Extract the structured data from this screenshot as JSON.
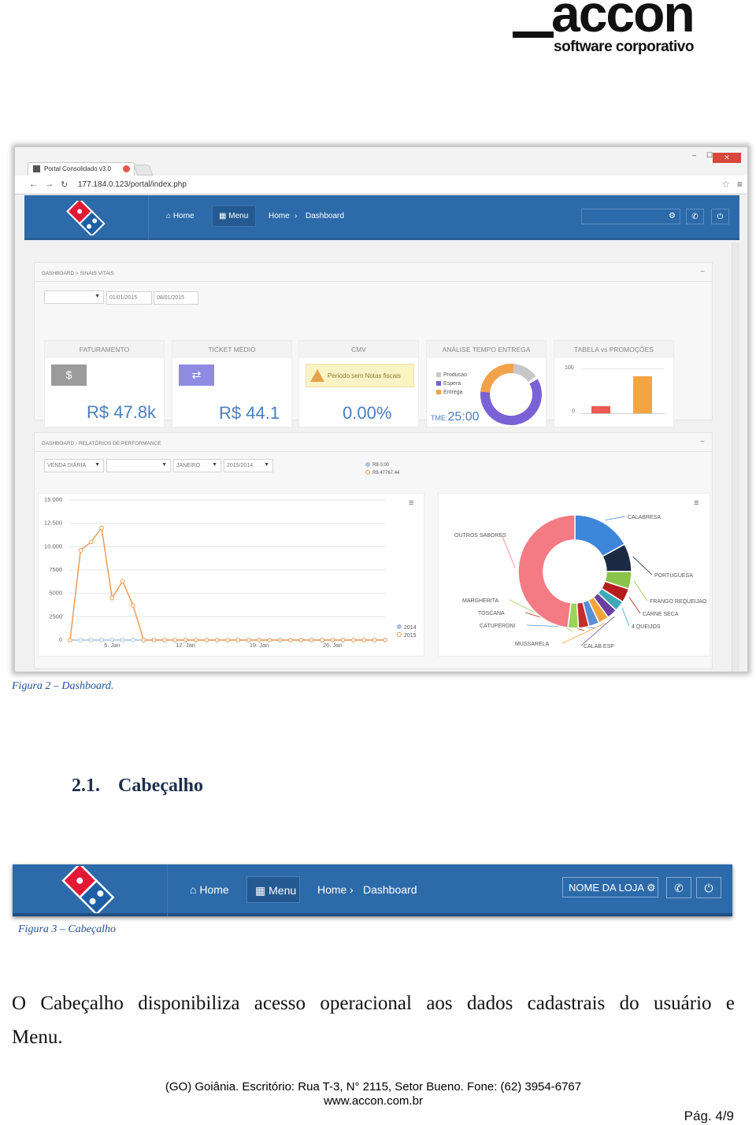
{
  "logo": {
    "word": "accon",
    "tagline": "software corporativo"
  },
  "browser": {
    "tab_title": "Portal Consolidado v3.0",
    "url": "177.184.0.123/portal/index.php",
    "close": "✕",
    "minimize": "–",
    "maximize": "☐"
  },
  "app_header": {
    "home": "Home",
    "menu": "Menu",
    "breadcrumb_home": "Home",
    "breadcrumb_dashboard": "Dashboard"
  },
  "vitals": {
    "title": "DASHBOARD > SINAIS VITAIS",
    "date_from": "01/01/2015",
    "date_to": "08/01/2015",
    "faturamento": {
      "title": "FATURAMENTO",
      "value": "R$ 47.8k"
    },
    "ticket": {
      "title": "TICKET MÉDIO",
      "value": "R$ 44.1"
    },
    "cmv": {
      "title": "CMV",
      "warning": "Período sem Notas fiscais",
      "value": "0.00%"
    },
    "tempo": {
      "title": "ANÁLISE TEMPO ENTREGA",
      "legend": [
        "Producao",
        "Espera",
        "Entrega"
      ],
      "tme_label": "TME:",
      "tme_value": "25:00"
    },
    "tabela": {
      "title": "TABELA vs PROMOÇÕES",
      "y_top": "100",
      "y_bottom": "0"
    }
  },
  "perf": {
    "title": "DASHBOARD › RELATÓRIOS DE PERFORMANCE",
    "filters": [
      "VENDA DIÁRIA",
      "",
      "JANEIRO",
      "2015/2014"
    ],
    "legend": [
      "R$ 0.00",
      "R$ 47767.44"
    ]
  },
  "chart_data": [
    {
      "type": "line",
      "title": "",
      "yticks": [
        "15.000",
        "12.500",
        "10.000",
        "7500",
        "5000",
        "2500",
        "0"
      ],
      "xticks": [
        "5. Jan",
        "12. Jan",
        "19. Jan",
        "26. Jan"
      ],
      "ylim": [
        0,
        15000
      ],
      "x": [
        1,
        2,
        3,
        4,
        5,
        6,
        7,
        8,
        9,
        10,
        11,
        12,
        13,
        14,
        15,
        16,
        17,
        18,
        19,
        20,
        21,
        22,
        23,
        24,
        25,
        26,
        27,
        28,
        29,
        30,
        31
      ],
      "series": [
        {
          "name": "2014",
          "color": "#a9c1e2",
          "values": [
            0,
            0,
            0,
            0,
            0,
            0,
            0,
            0,
            0,
            0,
            0,
            0,
            0,
            0,
            0,
            0,
            0,
            0,
            0,
            0,
            0,
            0,
            0,
            0,
            0,
            0,
            0,
            0,
            0,
            0,
            0
          ]
        },
        {
          "name": "2015",
          "color": "#ee9b55",
          "values": [
            0,
            9600,
            10500,
            12000,
            4500,
            6300,
            3700,
            0,
            0,
            0,
            0,
            0,
            0,
            0,
            0,
            0,
            0,
            0,
            0,
            0,
            0,
            0,
            0,
            0,
            0,
            0,
            0,
            0,
            0,
            0,
            0
          ]
        }
      ]
    },
    {
      "type": "pie",
      "title": "",
      "labels": [
        "CALABRESA",
        "PORTUGUESA",
        "FRANGO REQUEIJAO",
        "CARNE SECA",
        "4 QUEIJOS",
        "CALAB ESP",
        "MUSSARELA",
        "CATUPERONI",
        "TOSCANA",
        "MARGHERITA",
        "OUTROS SABORES"
      ],
      "values": [
        17,
        8,
        5,
        4,
        3,
        3,
        3,
        3,
        3,
        3,
        48
      ],
      "colors": [
        "#3d86d9",
        "#1d2a44",
        "#8bc34a",
        "#b71c1c",
        "#3fa9b7",
        "#6a3fa0",
        "#f3a43b",
        "#5a8fd6",
        "#c62d2d",
        "#9bd35b",
        "#f47a84"
      ]
    }
  ],
  "figure2_caption": "Figura 2 – Dashboard.",
  "section": {
    "number": "2.1.",
    "title": "Cabeçalho"
  },
  "header_fig": {
    "home": "Home",
    "menu": "Menu",
    "breadcrumb_home": "Home",
    "breadcrumb_dashboard": "Dashboard",
    "store": "NOME DA LOJA"
  },
  "figure3_caption": "Figura 3 – Cabeçalho",
  "paragraph": {
    "line1": "O Cabeçalho disponibiliza acesso operacional aos dados cadastrais do usuário e",
    "line2": "Menu."
  },
  "footer": {
    "address": "(GO) Goiânia. Escritório: Rua T-3, N° 2115, Setor Bueno. Fone: (62) 3954-6767",
    "site": "www.accon.com.br",
    "page": "Pág. 4/9"
  }
}
